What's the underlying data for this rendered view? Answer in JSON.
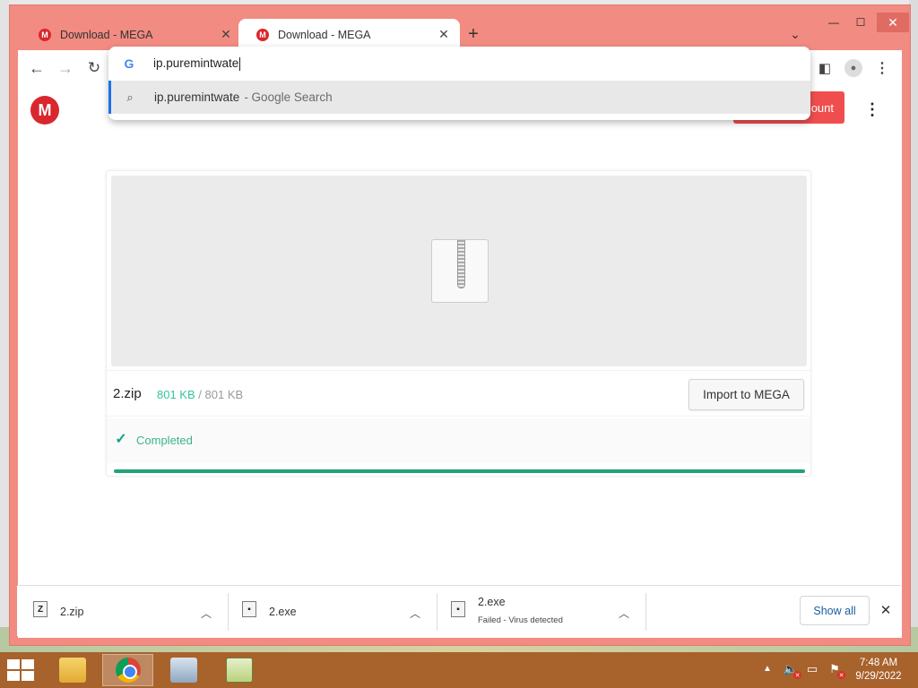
{
  "browser": {
    "tabs": [
      {
        "title": "Download - MEGA",
        "favicon": "M",
        "active": false
      },
      {
        "title": "Download - MEGA",
        "favicon": "M",
        "active": true
      }
    ],
    "new_tab_icon": "+",
    "tab_search_icon": "⌄",
    "window_controls": {
      "minimize": "—",
      "maximize": "☐",
      "close": "✕"
    },
    "toolbar_icons": [
      "back-arrow-icon",
      "forward-arrow-icon",
      "reload-icon",
      "side-panel-icon",
      "profile-icon",
      "menu-icon"
    ]
  },
  "omnibox": {
    "typed_text": "ip.puremintwate",
    "google_icon": "G",
    "suggestion": {
      "text": "ip.puremintwate",
      "hint": "- Google Search"
    }
  },
  "mega": {
    "logo_letter": "M",
    "create_account_label": "ount",
    "file": {
      "name": "2.zip",
      "downloaded": "801 KB",
      "separator": "/",
      "total": "801 KB"
    },
    "import_label": "Import to MEGA",
    "status": "Completed",
    "progress": 1.0
  },
  "downloads": {
    "items": [
      {
        "name": "2.zip",
        "icon": "Z",
        "status": ""
      },
      {
        "name": "2.exe",
        "icon": "▪",
        "status": ""
      },
      {
        "name": "2.exe",
        "icon": "▪",
        "status": "Failed - Virus detected"
      }
    ],
    "show_all_label": "Show all"
  },
  "taskbar": {
    "apps": [
      "explorer",
      "chrome",
      "performance-monitor",
      "notepad-plus"
    ],
    "active_app": "chrome",
    "clock": {
      "time": "7:48 AM",
      "date": "9/29/2022"
    }
  },
  "colors": {
    "window_frame": "#f28b82",
    "mega_red": "#d9272e",
    "progress_green": "#21a374",
    "taskbar": "#a8622c"
  }
}
